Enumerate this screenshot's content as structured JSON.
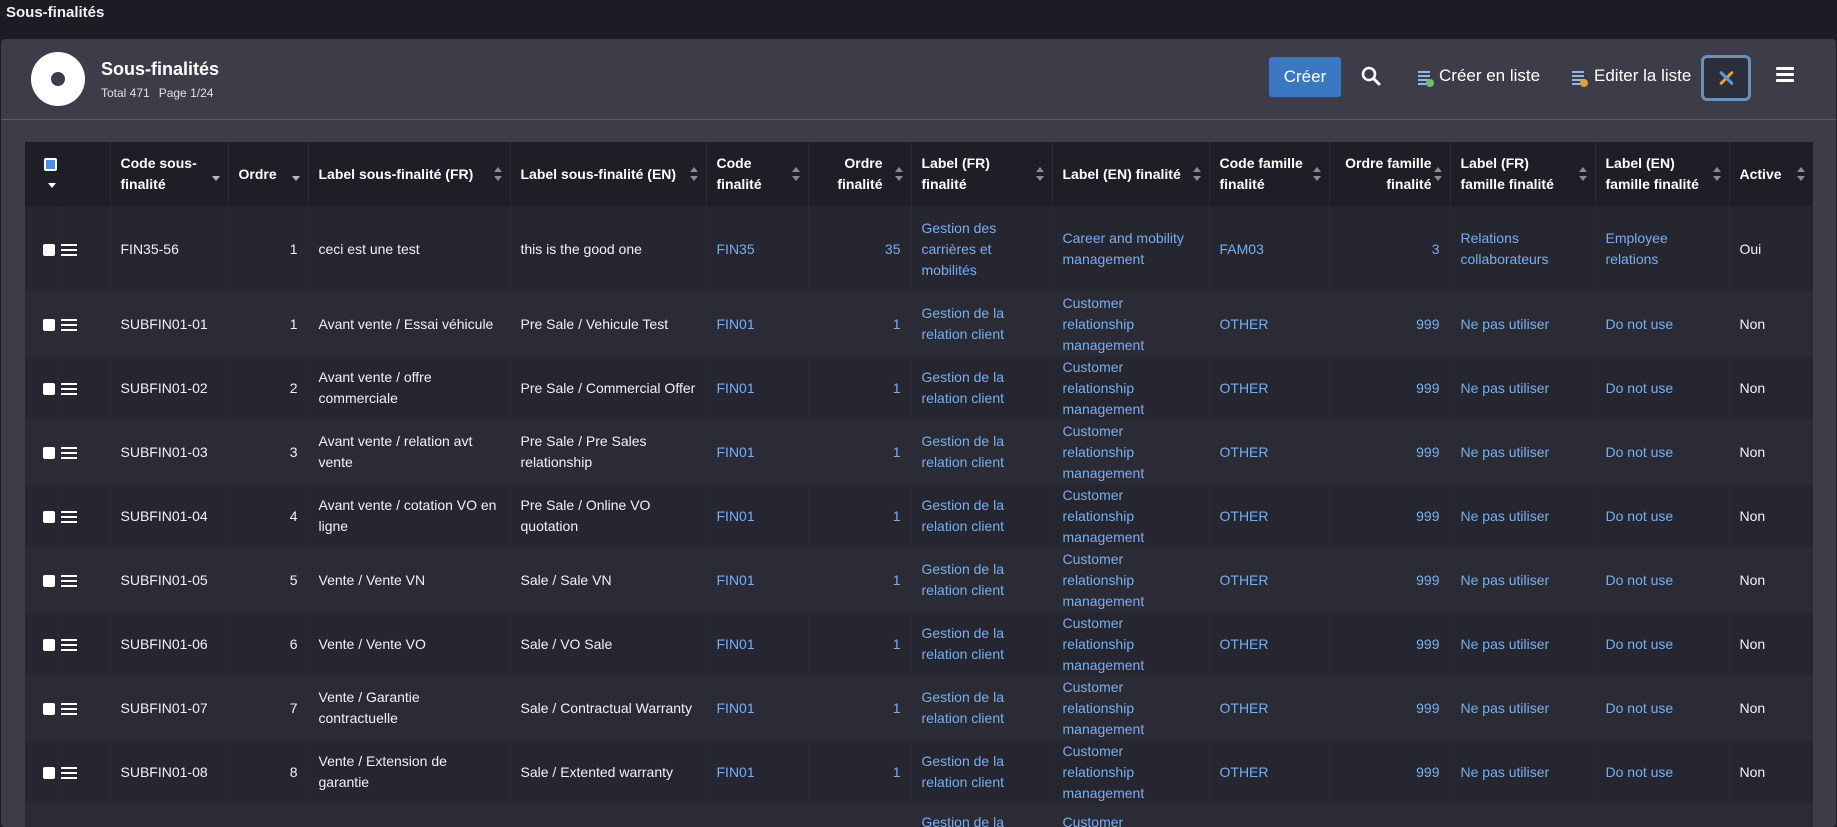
{
  "window": {
    "title": "Sous-finalités"
  },
  "header": {
    "title": "Sous-finalités",
    "total": "Total 471",
    "page": "Page 1/24"
  },
  "toolbar": {
    "create_label": "Créer",
    "create_list_label": "Créer en liste",
    "edit_list_label": "Editer la liste"
  },
  "colors": {
    "accent": "#3a79c2",
    "link": "#78aef0",
    "panel": "#3d3d4a"
  },
  "table": {
    "columns": [
      "Code sous-finalité",
      "Ordre",
      "Label sous-finalité (FR)",
      "Label sous-finalité (EN)",
      "Code finalité",
      "Ordre finalité",
      "Label (FR) finalité",
      "Label (EN) finalité",
      "Code famille finalité",
      "Ordre famille finalité",
      "Label (FR) famille finalité",
      "Label (EN) famille finalité",
      "Active"
    ],
    "rows": [
      [
        "FIN35-56",
        "1",
        "ceci est une test",
        "this is the good one",
        "FIN35",
        "35",
        "Gestion des carrières et mobilités",
        "Career and mobility management",
        "FAM03",
        "3",
        "Relations collaborateurs",
        "Employee relations",
        "Oui"
      ],
      [
        "SUBFIN01-01",
        "1",
        "Avant vente / Essai véhicule",
        "Pre Sale / Vehicule Test",
        "FIN01",
        "1",
        "Gestion de la relation client",
        "Customer relationship management",
        "OTHER",
        "999",
        "Ne pas utiliser",
        "Do not use",
        "Non"
      ],
      [
        "SUBFIN01-02",
        "2",
        "Avant vente / offre commerciale",
        "Pre Sale / Commercial Offer",
        "FIN01",
        "1",
        "Gestion de la relation client",
        "Customer relationship management",
        "OTHER",
        "999",
        "Ne pas utiliser",
        "Do not use",
        "Non"
      ],
      [
        "SUBFIN01-03",
        "3",
        "Avant vente / relation avt vente",
        "Pre Sale / Pre Sales relationship",
        "FIN01",
        "1",
        "Gestion de la relation client",
        "Customer relationship management",
        "OTHER",
        "999",
        "Ne pas utiliser",
        "Do not use",
        "Non"
      ],
      [
        "SUBFIN01-04",
        "4",
        "Avant vente / cotation VO en ligne",
        "Pre Sale / Online VO quotation",
        "FIN01",
        "1",
        "Gestion de la relation client",
        "Customer relationship management",
        "OTHER",
        "999",
        "Ne pas utiliser",
        "Do not use",
        "Non"
      ],
      [
        "SUBFIN01-05",
        "5",
        "Vente / Vente VN",
        "Sale / Sale VN",
        "FIN01",
        "1",
        "Gestion de la relation client",
        "Customer relationship management",
        "OTHER",
        "999",
        "Ne pas utiliser",
        "Do not use",
        "Non"
      ],
      [
        "SUBFIN01-06",
        "6",
        "Vente / Vente VO",
        "Sale / VO Sale",
        "FIN01",
        "1",
        "Gestion de la relation client",
        "Customer relationship management",
        "OTHER",
        "999",
        "Ne pas utiliser",
        "Do not use",
        "Non"
      ],
      [
        "SUBFIN01-07",
        "7",
        "Vente / Garantie contractuelle",
        "Sale / Contractual Warranty",
        "FIN01",
        "1",
        "Gestion de la relation client",
        "Customer relationship management",
        "OTHER",
        "999",
        "Ne pas utiliser",
        "Do not use",
        "Non"
      ],
      [
        "SUBFIN01-08",
        "8",
        "Vente / Extension de garantie",
        "Sale / Extented warranty",
        "FIN01",
        "1",
        "Gestion de la relation client",
        "Customer relationship management",
        "OTHER",
        "999",
        "Ne pas utiliser",
        "Do not use",
        "Non"
      ],
      [
        "",
        "",
        "",
        "",
        "",
        "",
        "Gestion de la",
        "Customer relationship",
        "",
        "",
        "",
        "",
        ""
      ]
    ]
  }
}
